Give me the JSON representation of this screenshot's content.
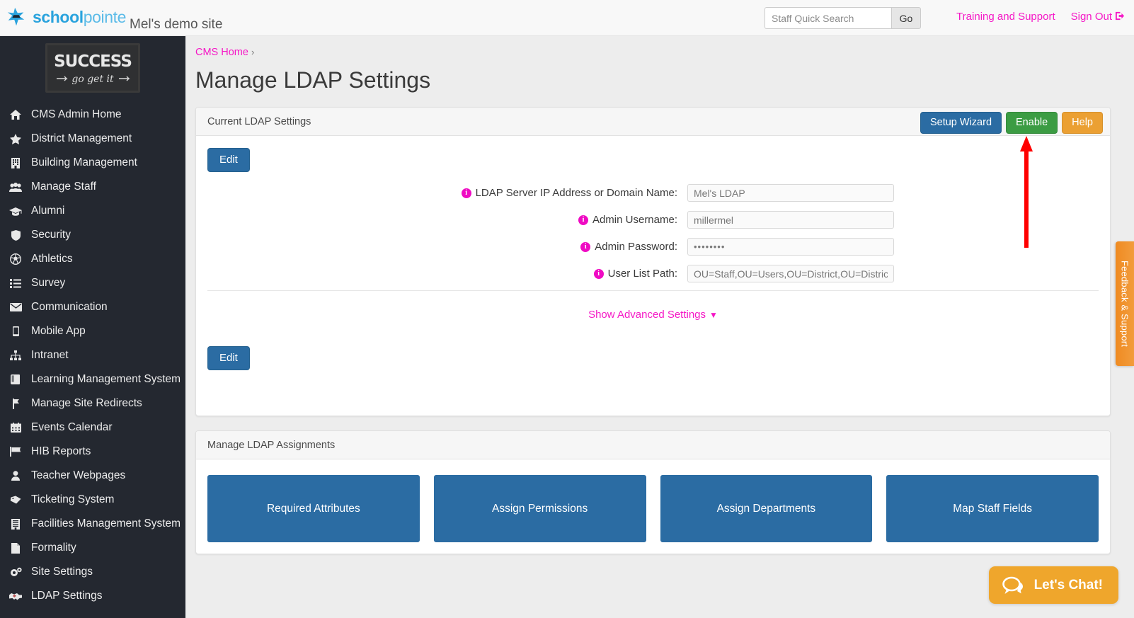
{
  "header": {
    "brand_bold": "school",
    "brand_light": "pointe",
    "site_name": "Mel's demo site",
    "search_placeholder": "Staff Quick Search",
    "search_value": "",
    "go_label": "Go",
    "training_link": "Training and Support",
    "signout_link": "Sign Out"
  },
  "sidebar": {
    "logo_alt": "SUCCESS go get it",
    "logo_line1": "SUCCESS",
    "logo_line2": "go get it",
    "items": [
      {
        "label": "CMS Admin Home",
        "icon": "home-icon"
      },
      {
        "label": "District Management",
        "icon": "star-icon"
      },
      {
        "label": "Building Management",
        "icon": "building-icon"
      },
      {
        "label": "Manage Staff",
        "icon": "users-icon"
      },
      {
        "label": "Alumni",
        "icon": "graduation-cap-icon"
      },
      {
        "label": "Security",
        "icon": "shield-icon"
      },
      {
        "label": "Athletics",
        "icon": "soccer-ball-icon"
      },
      {
        "label": "Survey",
        "icon": "list-icon"
      },
      {
        "label": "Communication",
        "icon": "envelope-icon"
      },
      {
        "label": "Mobile App",
        "icon": "mobile-icon"
      },
      {
        "label": "Intranet",
        "icon": "sitemap-icon"
      },
      {
        "label": "Learning Management System",
        "icon": "book-icon"
      },
      {
        "label": "Manage Site Redirects",
        "icon": "code-branch-icon"
      },
      {
        "label": "Events Calendar",
        "icon": "calendar-icon"
      },
      {
        "label": "HIB Reports",
        "icon": "flag-icon"
      },
      {
        "label": "Teacher Webpages",
        "icon": "person-icon"
      },
      {
        "label": "Ticketing System",
        "icon": "ticket-icon"
      },
      {
        "label": "Facilities Management System",
        "icon": "office-building-icon"
      },
      {
        "label": "Formality",
        "icon": "document-icon"
      },
      {
        "label": "Site Settings",
        "icon": "gears-icon"
      },
      {
        "label": "LDAP Settings",
        "icon": "handshake-icon"
      }
    ]
  },
  "main": {
    "breadcrumb": "CMS Home",
    "breadcrumb_separator": "›",
    "page_title": "Manage LDAP Settings"
  },
  "settings_panel": {
    "title": "Current LDAP Settings",
    "setup_wizard_label": "Setup Wizard",
    "enable_label": "Enable",
    "help_label": "Help",
    "edit_top_label": "Edit",
    "edit_bottom_label": "Edit",
    "advanced_toggle": "Show Advanced Settings",
    "advanced_chevron": "⌄",
    "fields": [
      {
        "label": "LDAP Server IP Address or Domain Name:",
        "value": "Mel's LDAP",
        "type": "text"
      },
      {
        "label": "Admin Username:",
        "value": "millermel",
        "type": "text"
      },
      {
        "label": "Admin Password:",
        "value": "••••••••",
        "type": "password"
      },
      {
        "label": "User List Path:",
        "value": "OU=Staff,OU=Users,OU=District,OU=Districts,",
        "type": "text"
      }
    ]
  },
  "assign_panel": {
    "title": "Manage LDAP Assignments",
    "tiles": [
      {
        "label": "Required Attributes"
      },
      {
        "label": "Assign Permissions"
      },
      {
        "label": "Assign Departments"
      },
      {
        "label": "Map Staff Fields"
      }
    ]
  },
  "feedback_tab": {
    "label": "Feedback & Support"
  },
  "chat_widget": {
    "label": "Let's Chat!"
  },
  "annotation": {
    "arrow_color": "#ff0000",
    "points_to": "Enable"
  },
  "colors": {
    "sidebar_bg": "#242830",
    "accent_pink": "#f518c6",
    "primary_blue": "#2b6ca3",
    "success_green": "#3c9c43",
    "warning_orange": "#eba033",
    "page_bg": "#ededed"
  }
}
